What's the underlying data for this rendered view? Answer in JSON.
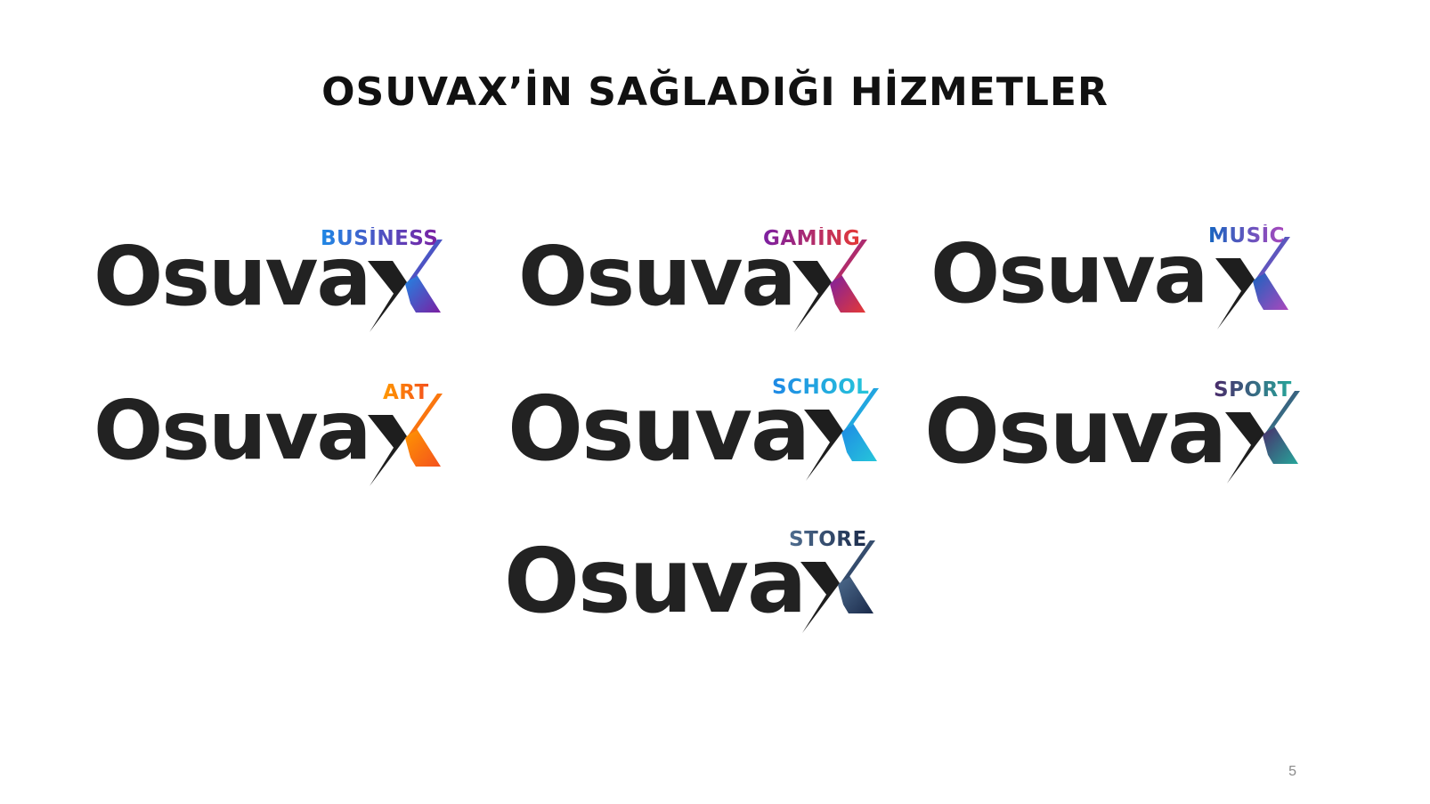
{
  "slide": {
    "title": "OSUVAX’İN SAĞLADIĞI HİZMETLER",
    "page_number": "5"
  },
  "logos": [
    {
      "id": "business",
      "wordmark": "Osuva",
      "sub": "BUSİNESS",
      "colors": [
        "#1e88e5",
        "#7b1fa2"
      ]
    },
    {
      "id": "gaming",
      "wordmark": "Osuva",
      "sub": "GAMİNG",
      "colors": [
        "#7b1fa2",
        "#e53935"
      ]
    },
    {
      "id": "music",
      "wordmark": "Osuva",
      "sub": "MUSİC",
      "colors": [
        "#1565c0",
        "#ab47bc"
      ]
    },
    {
      "id": "art",
      "wordmark": "Osuva",
      "sub": "ART",
      "colors": [
        "#ff9800",
        "#f4511e"
      ]
    },
    {
      "id": "school",
      "wordmark": "Osuva",
      "sub": "SCHOOL",
      "colors": [
        "#1e88e5",
        "#26c6da"
      ]
    },
    {
      "id": "sport",
      "wordmark": "Osuva",
      "sub": "SPORT",
      "colors": [
        "#4a2a6a",
        "#26a69a"
      ]
    },
    {
      "id": "store",
      "wordmark": "Osuva",
      "sub": "STORE",
      "colors": [
        "#4f6d8f",
        "#1a2a4a"
      ]
    }
  ]
}
